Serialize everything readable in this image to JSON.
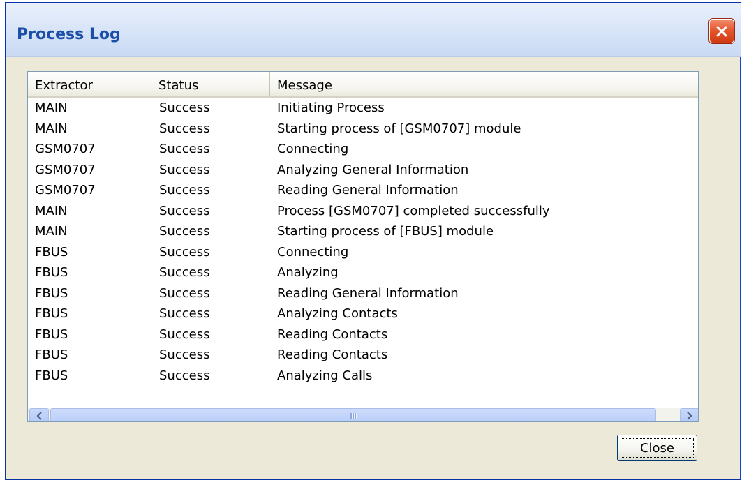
{
  "window": {
    "title": "Process Log"
  },
  "table": {
    "columns": [
      "Extractor",
      "Status",
      "Message"
    ],
    "rows": [
      {
        "extractor": "MAIN",
        "status": "Success",
        "message": "Initiating Process"
      },
      {
        "extractor": "MAIN",
        "status": "Success",
        "message": "Starting process of [GSM0707] module"
      },
      {
        "extractor": "GSM0707",
        "status": "Success",
        "message": "Connecting"
      },
      {
        "extractor": "GSM0707",
        "status": "Success",
        "message": "Analyzing General Information"
      },
      {
        "extractor": "GSM0707",
        "status": "Success",
        "message": "Reading General Information"
      },
      {
        "extractor": "MAIN",
        "status": "Success",
        "message": "Process [GSM0707] completed successfully"
      },
      {
        "extractor": "MAIN",
        "status": "Success",
        "message": "Starting process of [FBUS] module"
      },
      {
        "extractor": "FBUS",
        "status": "Success",
        "message": "Connecting"
      },
      {
        "extractor": "FBUS",
        "status": "Success",
        "message": "Analyzing"
      },
      {
        "extractor": "FBUS",
        "status": "Success",
        "message": "Reading General Information"
      },
      {
        "extractor": "FBUS",
        "status": "Success",
        "message": "Analyzing Contacts"
      },
      {
        "extractor": "FBUS",
        "status": "Success",
        "message": "Reading Contacts"
      },
      {
        "extractor": "FBUS",
        "status": "Success",
        "message": "Reading Contacts"
      },
      {
        "extractor": "FBUS",
        "status": "Success",
        "message": "Analyzing Calls"
      }
    ]
  },
  "buttons": {
    "close_label": "Close"
  },
  "icons": {
    "title_close": "close-icon",
    "scroll_up": "chevron-up-icon",
    "scroll_down": "chevron-down-icon",
    "scroll_left": "chevron-left-icon",
    "scroll_right": "chevron-right-icon"
  },
  "colors": {
    "titlebar_text": "#1c4fa8",
    "close_button": "#e5582f",
    "client_bg": "#ece9d8",
    "scroll_accent": "#4d6185"
  }
}
